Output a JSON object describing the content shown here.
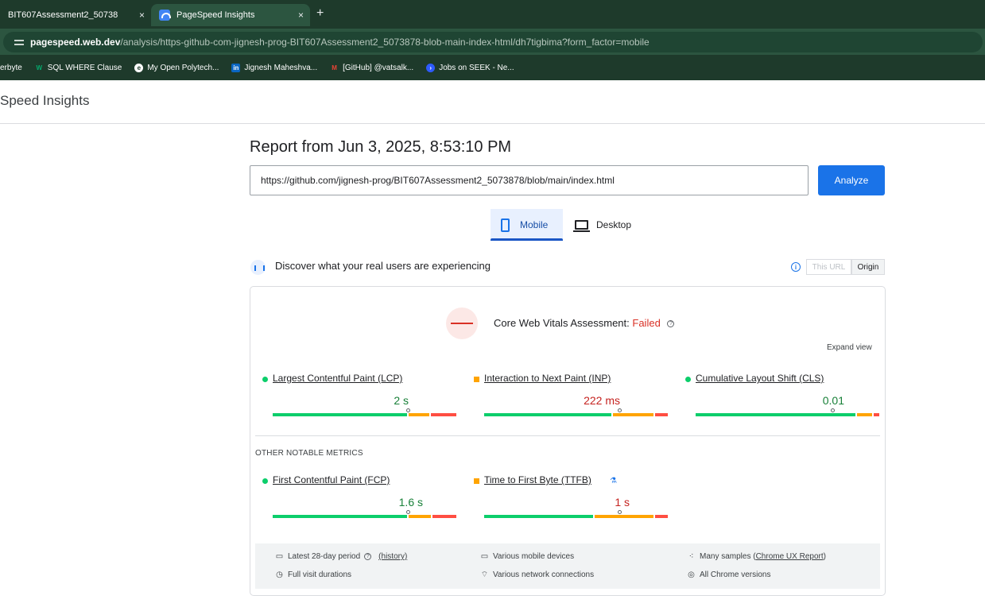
{
  "browser": {
    "tabs": [
      {
        "label": "BIT607Assessment2_50738",
        "close": "×"
      },
      {
        "label": "PageSpeed Insights",
        "close": "×"
      }
    ],
    "new_tab": "+",
    "url_domain": "pagespeed.web.dev",
    "url_rest": "/analysis/https-github-com-jignesh-prog-BIT607Assessment2_5073878-blob-main-index-html/dh7tigbima?form_factor=mobile",
    "bookmarks": [
      {
        "label": "erbyte"
      },
      {
        "label": "SQL WHERE Clause",
        "icon": "w3-icon"
      },
      {
        "label": "My Open Polytech...",
        "icon": "polytech-icon"
      },
      {
        "label": "Jignesh Maheshva...",
        "icon": "linkedin-icon"
      },
      {
        "label": "[GitHub] @vatsalk...",
        "icon": "gmail-icon"
      },
      {
        "label": "Jobs on SEEK - Ne...",
        "icon": "seek-icon"
      }
    ]
  },
  "header": {
    "site_title": "Speed Insights"
  },
  "report": {
    "title": "Report from Jun 3, 2025, 8:53:10 PM",
    "url_value": "https://github.com/jignesh-prog/BIT607Assessment2_5073878/blob/main/index.html",
    "analyze_label": "Analyze"
  },
  "form_factor": {
    "mobile": "Mobile",
    "desktop": "Desktop"
  },
  "crux": {
    "heading": "Discover what your real users are experiencing",
    "info": "i",
    "toggle_url": "This URL",
    "toggle_origin": "Origin"
  },
  "assessment": {
    "label": "Core Web Vitals Assessment:",
    "status": "Failed",
    "help": "?",
    "expand": "Expand view"
  },
  "core_metrics": [
    {
      "label": "Largest Contentful Paint (LCP)",
      "value": "2 s",
      "rating": "good",
      "dist": [
        0.74,
        0.12,
        0.14
      ],
      "marker": 0.74
    },
    {
      "label": "Interaction to Next Paint (INP)",
      "value": "222 ms",
      "rating": "average",
      "dist": [
        0.7,
        0.23,
        0.07
      ],
      "marker": 0.74
    },
    {
      "label": "Cumulative Layout Shift (CLS)",
      "value": "0.01",
      "rating": "good",
      "dist": [
        0.88,
        0.09,
        0.03
      ],
      "marker": 0.75
    }
  ],
  "other_section_label": "OTHER NOTABLE METRICS",
  "other_metrics": [
    {
      "label": "First Contentful Paint (FCP)",
      "value": "1.6 s",
      "rating": "good",
      "dist": [
        0.74,
        0.13,
        0.13
      ],
      "marker": 0.74
    },
    {
      "label": "Time to First Byte (TTFB)",
      "value": "1 s",
      "rating": "average",
      "dist": [
        0.6,
        0.33,
        0.07
      ],
      "marker": 0.74
    }
  ],
  "lab_icon": "⚗",
  "footer": {
    "period": "Latest 28-day period",
    "history": "(history)",
    "devices": "Various mobile devices",
    "samples": "Many samples",
    "samples_link": "Chrome UX Report",
    "durations": "Full visit durations",
    "network": "Various network connections",
    "versions": "All Chrome versions"
  }
}
